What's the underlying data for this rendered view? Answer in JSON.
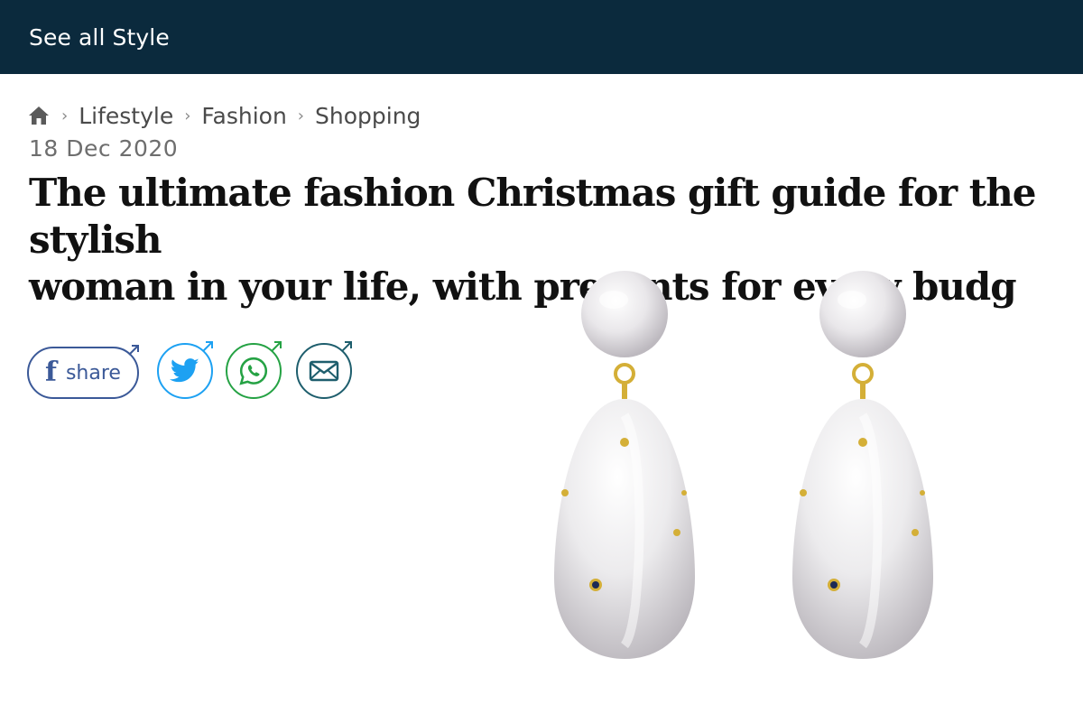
{
  "topbar": {
    "link_label": "See all Style"
  },
  "breadcrumb": {
    "home_icon": "home-icon",
    "items": [
      "Lifestyle",
      "Fashion",
      "Shopping"
    ],
    "separator": "›"
  },
  "article": {
    "date": "18 Dec 2020",
    "headline_line1": "The ultimate fashion Christmas gift guide for the stylish",
    "headline_line2": "woman in your life, with presents for every budg"
  },
  "share": {
    "facebook_label": "share",
    "facebook_icon": "facebook-icon",
    "twitter_icon": "twitter-icon",
    "whatsapp_icon": "whatsapp-icon",
    "email_icon": "email-icon"
  },
  "colors": {
    "topbar_bg": "#0b2a3d",
    "facebook": "#3b5998",
    "twitter": "#1da1f2",
    "whatsapp": "#25a244",
    "email": "#1e5e6d"
  }
}
